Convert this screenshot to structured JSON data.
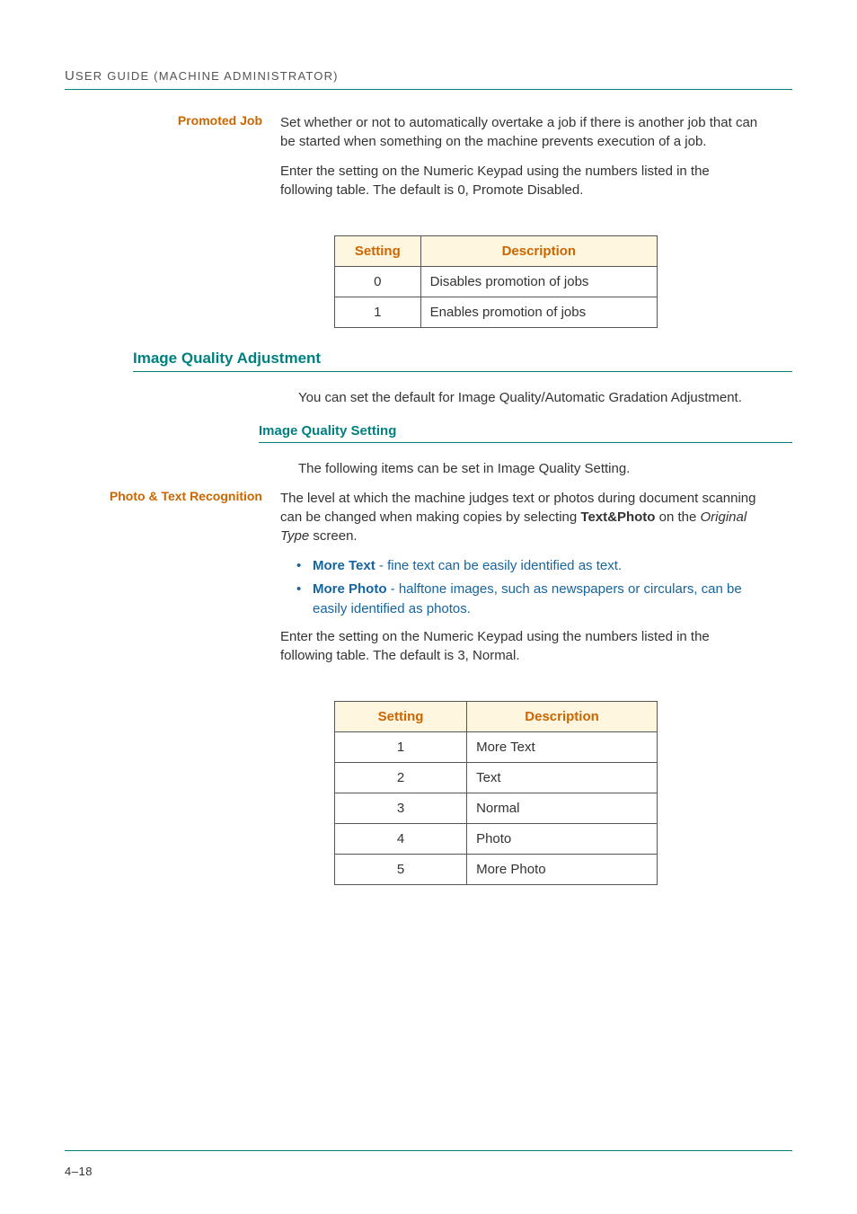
{
  "header": {
    "running_header_left": "U",
    "running_header_rest": "SER GUIDE (MACHINE ADMINISTRATOR)"
  },
  "promoted_job": {
    "label": "Promoted Job",
    "p1": "Set whether or not to automatically overtake a job if there is another job that can be started when something on the machine prevents execution of a job.",
    "p2": "Enter the setting on the Numeric Keypad using the numbers listed in the following table. The default is 0, Promote Disabled.",
    "table": {
      "col_setting": "Setting",
      "col_desc": "Description",
      "rows": [
        {
          "setting": "0",
          "desc": "Disables promotion of jobs"
        },
        {
          "setting": "1",
          "desc": "Enables promotion of jobs"
        }
      ]
    }
  },
  "iqa": {
    "heading": "Image Quality Adjustment",
    "p1": "You can set the default for Image Quality/Automatic Gradation Adjustment."
  },
  "iqs": {
    "heading": "Image Quality Setting",
    "p1": "The following items can be set in Image Quality Setting."
  },
  "ptr": {
    "label": "Photo & Text Recognition",
    "p1_prefix": "The level at which the machine judges text or photos during document scanning can be changed when making copies by selecting ",
    "p1_bold": "Text&Photo",
    "p1_mid": " on the ",
    "p1_italic": "Original Type",
    "p1_suffix": " screen.",
    "bullet1_bold": "More Text",
    "bullet1_rest": " - fine text can be easily identified as text.",
    "bullet2_bold": "More Photo",
    "bullet2_rest": " - halftone images, such as newspapers or circulars, can be easily identified as photos.",
    "p2": "Enter the setting on the Numeric Keypad using the numbers listed in the following table. The default is 3, Normal.",
    "table": {
      "col_setting": "Setting",
      "col_desc": "Description",
      "rows": [
        {
          "setting": "1",
          "desc": "More Text"
        },
        {
          "setting": "2",
          "desc": "Text"
        },
        {
          "setting": "3",
          "desc": "Normal"
        },
        {
          "setting": "4",
          "desc": "Photo"
        },
        {
          "setting": "5",
          "desc": "More Photo"
        }
      ]
    }
  },
  "footer": {
    "page_number": "4–18"
  }
}
